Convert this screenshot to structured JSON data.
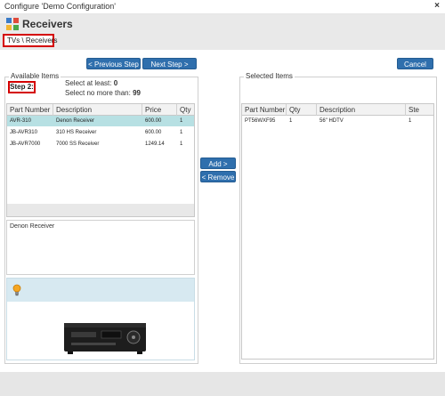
{
  "window": {
    "title": "Configure 'Demo Configuration'",
    "close_glyph": "×"
  },
  "header": {
    "step_title": "Receivers",
    "breadcrumb": "TVs \\ Receivers"
  },
  "nav": {
    "previous": "< Previous Step",
    "next": "Next Step >",
    "cancel": "Cancel"
  },
  "available": {
    "legend": "Available Items",
    "step_label": "Step 2:",
    "rule_min_label": "Select at least:",
    "rule_min_value": "0",
    "rule_max_label": "Select no more than:",
    "rule_max_value": "99",
    "columns": [
      "Part Number",
      "Description",
      "Price",
      "Qty"
    ],
    "rows": [
      {
        "part": "AVR-310",
        "desc": "Denon Receiver",
        "price": "600.00",
        "qty": "1",
        "selected": true
      },
      {
        "part": "JB-AVR310",
        "desc": "310 HS Receiver",
        "price": "600.00",
        "qty": "1",
        "selected": false
      },
      {
        "part": "JB-AVR7000",
        "desc": "7000 SS Receiver",
        "price": "1249.14",
        "qty": "1",
        "selected": false
      }
    ],
    "description_text": "Denon Receiver"
  },
  "actions": {
    "add": "Add >",
    "remove": "< Remove"
  },
  "selected": {
    "legend": "Selected Items",
    "columns": [
      "Part Number",
      "Qty",
      "Description",
      "Ste"
    ],
    "rows": [
      {
        "part": "PT56WXF95",
        "qty": "1",
        "desc": "56\" HDTV",
        "step": "1"
      }
    ]
  },
  "colors": {
    "primary_button": "#2f6fad",
    "selected_row": "#b7e0e3",
    "highlight_border": "#d40000"
  }
}
